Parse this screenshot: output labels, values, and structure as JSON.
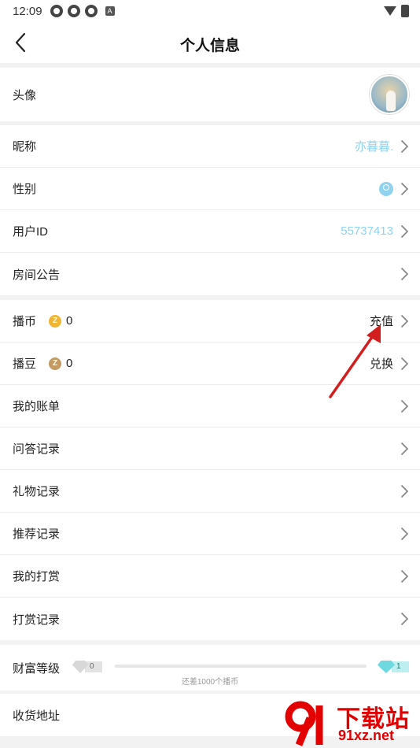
{
  "status_bar": {
    "time": "12:09",
    "letter_badge": "A"
  },
  "header": {
    "title": "个人信息"
  },
  "profile_section": {
    "avatar_label": "头像"
  },
  "info_section": {
    "nickname_label": "昵称",
    "nickname_value": "亦暮暮.",
    "gender_label": "性别",
    "user_id_label": "用户ID",
    "user_id_value": "55737413",
    "announcement_label": "房间公告"
  },
  "wallet_section": {
    "coins_label": "播币",
    "coins_icon_letter": "Z",
    "coins_count": "0",
    "coins_action": "充值",
    "beans_label": "播豆",
    "beans_icon_letter": "Z",
    "beans_count": "0",
    "beans_action": "兑换",
    "records": [
      "我的账单",
      "问答记录",
      "礼物记录",
      "推荐记录",
      "我的打赏",
      "打赏记录"
    ]
  },
  "wealth_section": {
    "label": "财富等级",
    "current_level": "0",
    "next_level": "1",
    "hint": "还差1000个播币",
    "progress": 0
  },
  "address_section": {
    "label": "收货地址"
  },
  "watermark": {
    "top_text": "下载站",
    "bottom_text": "91xz.net"
  },
  "colors": {
    "accent_blue": "#8fd3ef",
    "coin_gold": "#f2b532",
    "bean_brown": "#c49b62",
    "arrow_red": "#d21e1e"
  }
}
